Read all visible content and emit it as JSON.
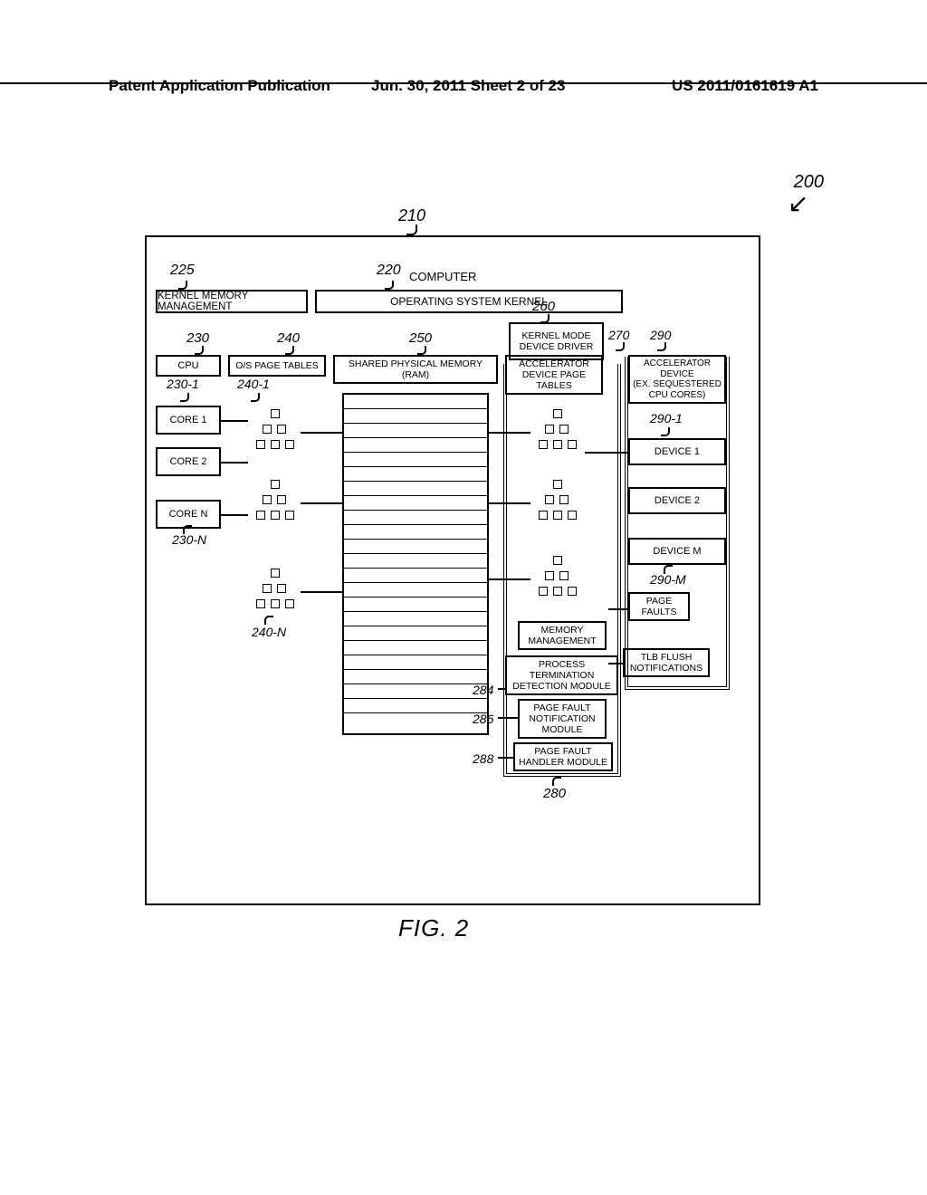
{
  "header": {
    "left": "Patent Application Publication",
    "center": "Jun. 30, 2011  Sheet 2 of 23",
    "right": "US 2011/0161619 A1"
  },
  "figure": {
    "label": "FIG. 2",
    "refs": {
      "r200": "200",
      "r210": "210",
      "r220": "220",
      "r225": "225",
      "r230": "230",
      "r240": "240",
      "r250": "250",
      "r260": "260",
      "r270": "270",
      "r290": "290",
      "r230_1": "230-1",
      "r230_n": "230-N",
      "r240_1": "240-1",
      "r240_n": "240-N",
      "r290_1": "290-1",
      "r290_m": "290-M",
      "r280": "280",
      "r284": "284",
      "r286": "286",
      "r288": "288"
    },
    "computer": "COMPUTER",
    "kmm": "KERNEL MEMORY MANAGEMENT",
    "osk": "OPERATING SYSTEM KERNEL",
    "kmdd_l1": "KERNEL MODE",
    "kmdd_l2": "DEVICE DRIVER",
    "cpu": "CPU",
    "core1": "CORE 1",
    "core2": "CORE 2",
    "coren": "CORE N",
    "ospt": "O/S PAGE TABLES",
    "spm_l1": "SHARED PHYSICAL MEMORY",
    "spm_l2": "(RAM)",
    "adpt_l1": "ACCELERATOR",
    "adpt_l2": "DEVICE PAGE",
    "adpt_l3": "TABLES",
    "mm_l1": "MEMORY",
    "mm_l2": "MANAGEMENT",
    "ptdm_l1": "PROCESS",
    "ptdm_l2": "TERMINATION",
    "ptdm_l3": "DETECTION MODULE",
    "pfnm_l1": "PAGE FAULT",
    "pfnm_l2": "NOTIFICATION",
    "pfnm_l3": "MODULE",
    "pfhm_l1": "PAGE FAULT",
    "pfhm_l2": "HANDLER MODULE",
    "accdev_l1": "ACCELERATOR",
    "accdev_l2": "DEVICE",
    "accdev_l3": "(EX. SEQUESTERED",
    "accdev_l4": "CPU CORES)",
    "dev1": "DEVICE 1",
    "dev2": "DEVICE 2",
    "devm": "DEVICE M",
    "pgf_l1": "PAGE",
    "pgf_l2": "FAULTS",
    "tlb_l1": "TLB FLUSH",
    "tlb_l2": "NOTIFICATIONS"
  }
}
